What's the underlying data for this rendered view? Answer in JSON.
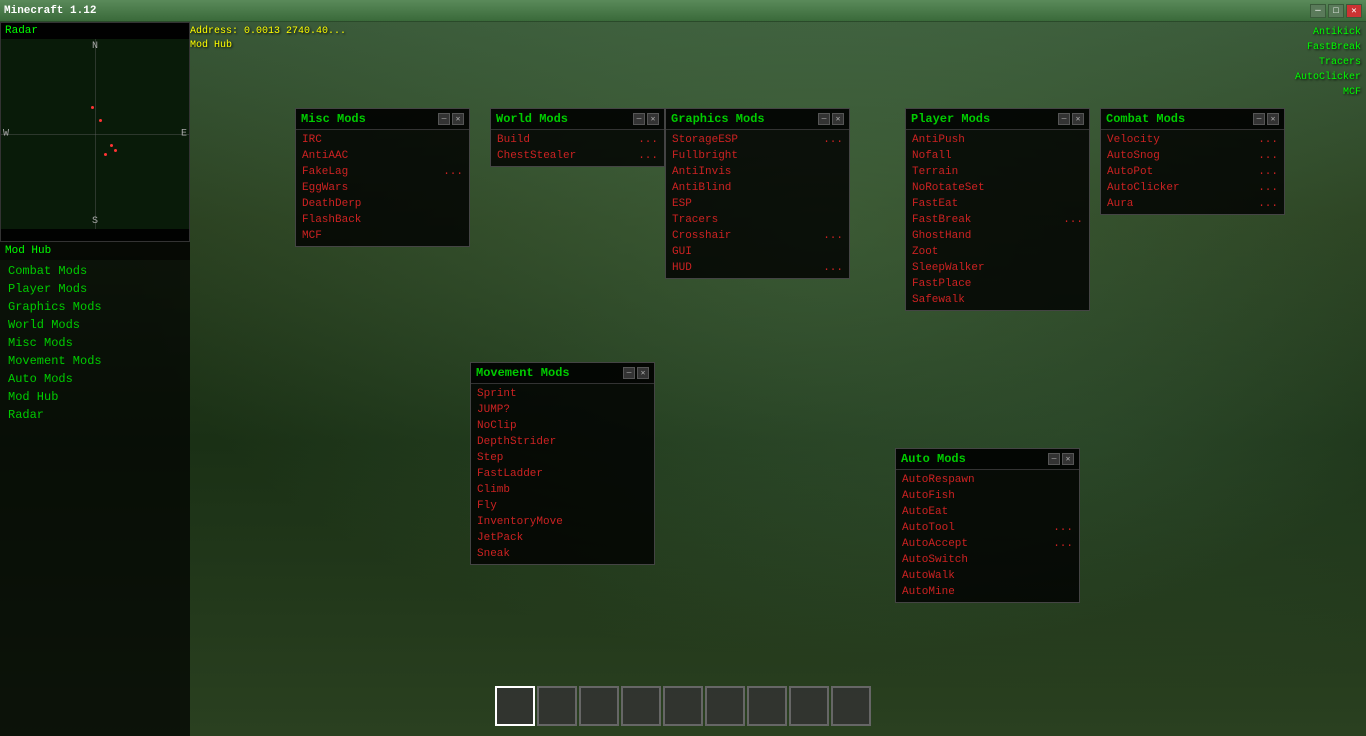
{
  "window": {
    "title": "Minecraft 1.12",
    "minimize_label": "─",
    "restore_label": "□",
    "close_label": "✕"
  },
  "coords": {
    "line1": "Address: 0.0013 2740.40...",
    "line2": "Mod Hub"
  },
  "topright": {
    "line1": "Antikick",
    "line2": "FastBreak",
    "line3": "Tracers",
    "line4": "AutoClicker",
    "line5": "MCF"
  },
  "sidebar": {
    "radar_title": "Radar",
    "modhub_title": "Mod Hub",
    "items": [
      {
        "label": "Combat Mods",
        "key": "combat-mods"
      },
      {
        "label": "Player Mods",
        "key": "player-mods"
      },
      {
        "label": "Graphics Mods",
        "key": "graphics-mods"
      },
      {
        "label": "World Mods",
        "key": "world-mods"
      },
      {
        "label": "Misc Mods",
        "key": "misc-mods"
      },
      {
        "label": "Movement Mods",
        "key": "movement-mods"
      },
      {
        "label": "Auto Mods",
        "key": "auto-mods"
      },
      {
        "label": "Mod Hub",
        "key": "mod-hub"
      },
      {
        "label": "Radar",
        "key": "radar"
      }
    ]
  },
  "misc_mods": {
    "title": "Misc Mods",
    "items": [
      {
        "label": "IRC",
        "has_dots": false
      },
      {
        "label": "AntiAAC",
        "has_dots": false
      },
      {
        "label": "FakeLag",
        "has_dots": true
      },
      {
        "label": "EggWars",
        "has_dots": false
      },
      {
        "label": "DeathDerp",
        "has_dots": false
      },
      {
        "label": "FlashBack",
        "has_dots": false
      },
      {
        "label": "MCF",
        "has_dots": false
      }
    ]
  },
  "world_mods": {
    "title": "World Mods",
    "items": [
      {
        "label": "Build",
        "has_dots": true
      },
      {
        "label": "ChestStealer",
        "has_dots": true
      }
    ]
  },
  "graphics_mods": {
    "title": "Graphics Mods",
    "items": [
      {
        "label": "StorageESP",
        "has_dots": true
      },
      {
        "label": "Fullbright",
        "has_dots": false
      },
      {
        "label": "AntiInvis",
        "has_dots": false
      },
      {
        "label": "AntiBlind",
        "has_dots": false
      },
      {
        "label": "ESP",
        "has_dots": false
      },
      {
        "label": "Tracers",
        "has_dots": false
      },
      {
        "label": "Crosshair",
        "has_dots": true
      },
      {
        "label": "GUI",
        "has_dots": false
      },
      {
        "label": "HUD",
        "has_dots": true
      }
    ]
  },
  "player_mods": {
    "title": "Player Mods",
    "items": [
      {
        "label": "AntiPush",
        "has_dots": false
      },
      {
        "label": "Nofall",
        "has_dots": false
      },
      {
        "label": "Terrain",
        "has_dots": false
      },
      {
        "label": "NoRotateSet",
        "has_dots": false
      },
      {
        "label": "FastEat",
        "has_dots": false
      },
      {
        "label": "FastBreak",
        "has_dots": true
      },
      {
        "label": "GhostHand",
        "has_dots": false
      },
      {
        "label": "Zoot",
        "has_dots": false
      },
      {
        "label": "SleepWalker",
        "has_dots": false
      },
      {
        "label": "FastPlace",
        "has_dots": false
      },
      {
        "label": "Safewalk",
        "has_dots": false
      }
    ]
  },
  "combat_mods": {
    "title": "Combat Mods",
    "items": [
      {
        "label": "Velocity",
        "has_dots": true
      },
      {
        "label": "AutoSnog",
        "has_dots": true
      },
      {
        "label": "AutoPot",
        "has_dots": true
      },
      {
        "label": "AutoClicker",
        "has_dots": true
      },
      {
        "label": "Aura",
        "has_dots": true
      }
    ]
  },
  "movement_mods": {
    "title": "Movement Mods",
    "items": [
      {
        "label": "Sprint",
        "has_dots": false
      },
      {
        "label": "JUMP?",
        "has_dots": false
      },
      {
        "label": "NoClip",
        "has_dots": false
      },
      {
        "label": "DepthStrider",
        "has_dots": false
      },
      {
        "label": "Step",
        "has_dots": false
      },
      {
        "label": "FastLadder",
        "has_dots": false
      },
      {
        "label": "Climb",
        "has_dots": false
      },
      {
        "label": "Fly",
        "has_dots": false
      },
      {
        "label": "InventoryMove",
        "has_dots": false
      },
      {
        "label": "JetPack",
        "has_dots": false
      },
      {
        "label": "Sneak",
        "has_dots": false
      }
    ]
  },
  "auto_mods": {
    "title": "Auto Mods",
    "items": [
      {
        "label": "AutoRespawn",
        "has_dots": false
      },
      {
        "label": "AutoFish",
        "has_dots": false
      },
      {
        "label": "AutoEat",
        "has_dots": false
      },
      {
        "label": "AutoTool",
        "has_dots": true
      },
      {
        "label": "AutoAccept",
        "has_dots": true
      },
      {
        "label": "AutoSwitch",
        "has_dots": false
      },
      {
        "label": "AutoWalk",
        "has_dots": false
      },
      {
        "label": "AutoMine",
        "has_dots": false
      }
    ]
  },
  "hotbar": {
    "slots": 9,
    "selected": 0
  }
}
